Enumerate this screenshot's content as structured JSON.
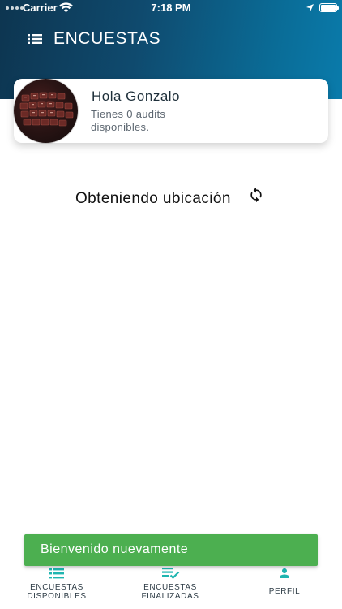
{
  "status_bar": {
    "carrier": "Carrier",
    "time": "7:18 PM",
    "icons": [
      "signal-dots-icon",
      "wifi-icon",
      "location-arrow-icon",
      "battery-icon"
    ]
  },
  "header": {
    "title": "ENCUESTAS",
    "menu_icon": "menu-list-icon"
  },
  "profile": {
    "greeting": "Hola Gonzalo",
    "audits_text": "Tienes 0 audits disponibles."
  },
  "location": {
    "status": "Obteniendo ubicación",
    "icon": "refresh-icon"
  },
  "toast": {
    "message": "Bienvenido nuevamente",
    "color": "#4caf50"
  },
  "tabbar": {
    "tabs": [
      {
        "line1": "ENCUESTAS",
        "line2": "DISPONIBLES",
        "icon": "list-icon"
      },
      {
        "line1": "ENCUESTAS",
        "line2": "FINALIZADAS",
        "icon": "checklist-icon"
      },
      {
        "line1": "PERFIL",
        "line2": "",
        "icon": "person-icon",
        "active": true
      }
    ]
  },
  "colors": {
    "header_start": "#0d3550",
    "header_end": "#0a7bab",
    "accent": "#1fb5b0"
  }
}
